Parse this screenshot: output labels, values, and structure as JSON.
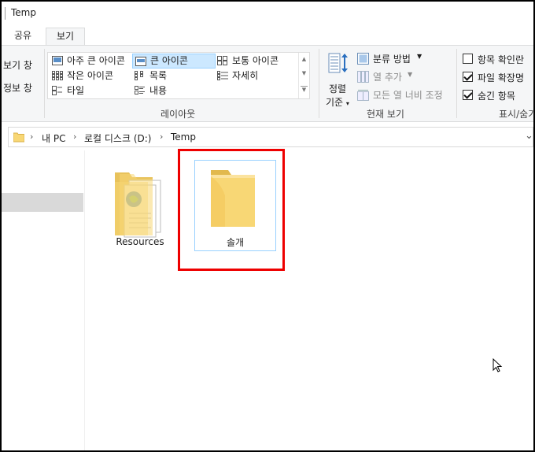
{
  "window": {
    "title": "Temp"
  },
  "tabs": [
    {
      "label": "공유"
    },
    {
      "label": "보기"
    }
  ],
  "ribbon": {
    "left_items": [
      "보기 창",
      "정보 창"
    ],
    "layout": {
      "items": [
        "아주 큰 아이콘",
        "큰 아이콘",
        "보통 아이콘",
        "작은 아이콘",
        "목록",
        "자세히",
        "타일",
        "내용"
      ],
      "selected": "큰 아이콘",
      "group_label": "레이아웃"
    },
    "current_view": {
      "sort_label_1": "정렬",
      "sort_label_2": "기준",
      "group_by": "분류 방법",
      "add_column": "열 추가",
      "size_all_columns": "모든 열 너비 조정",
      "group_label": "현재 보기"
    },
    "show_hide": {
      "item_checkboxes": {
        "label": "항목 확인란",
        "checked": false
      },
      "file_extensions": {
        "label": "파일 확장명",
        "checked": true
      },
      "hidden_items": {
        "label": "숨긴 항목",
        "checked": true
      },
      "group_label": "표시/숨기"
    }
  },
  "address": {
    "parts": [
      "내 PC",
      "로컬 디스크 (D:)",
      "Temp"
    ]
  },
  "files": [
    {
      "name": "Resources",
      "type": "folder-with-content"
    },
    {
      "name": "솔개",
      "type": "folder-empty",
      "selected": true
    }
  ],
  "colors": {
    "selection_fill": "#cce8ff",
    "selection_border": "#99d1ff",
    "highlight_box": "#e00000",
    "folder": "#f8d775"
  }
}
